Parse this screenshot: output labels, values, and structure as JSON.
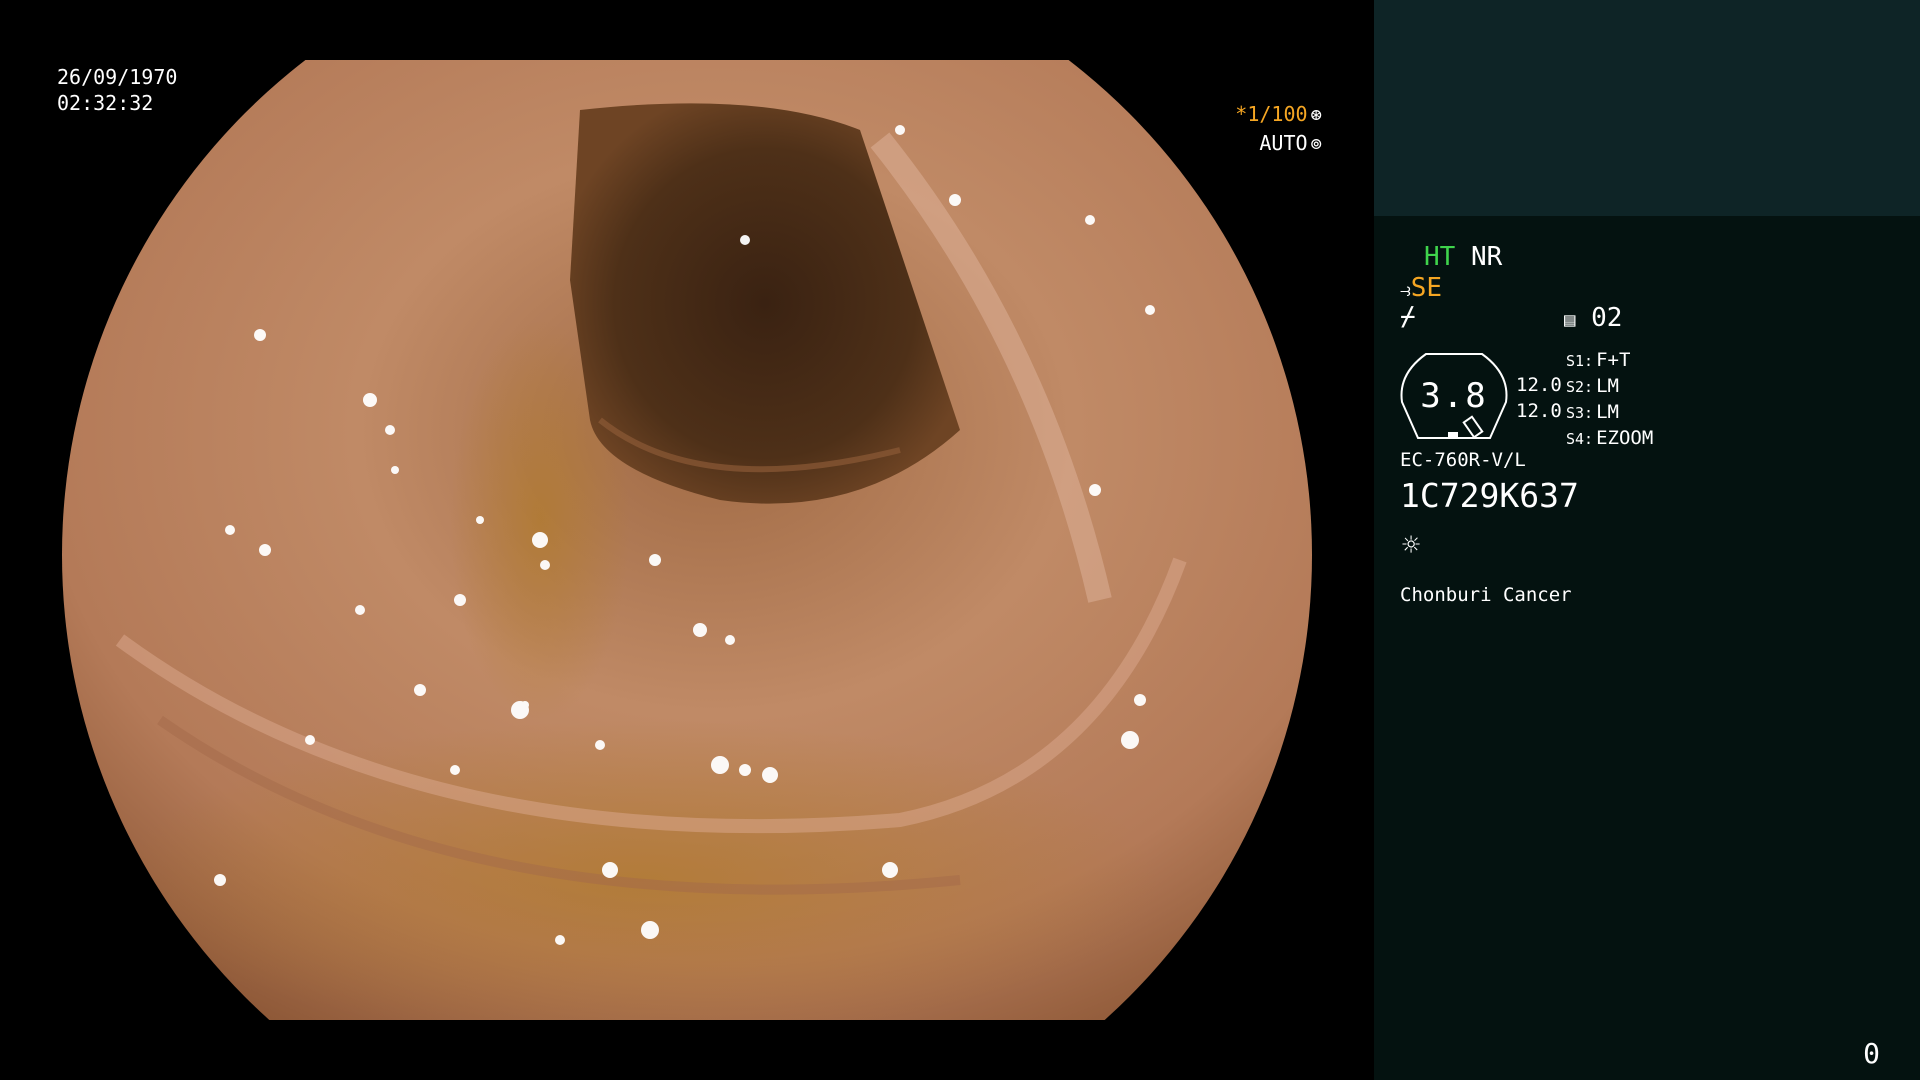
{
  "overlay": {
    "date": "26/09/1970",
    "time": "02:32:32",
    "shutter": "*1/100",
    "shutter_icon": "aperture-icon",
    "iris_mode": "AUTO",
    "iris_icon": "iris-icon"
  },
  "panel": {
    "ht": "HT",
    "nr": "NR",
    "se_icon": "cable-icon",
    "se": "SE",
    "freeze_icon": "freeze-icon",
    "memory_icon": "memory-card-icon",
    "memory": "02",
    "gauge_value": "3.8",
    "gauge_vals": [
      "12.0",
      "12.0"
    ],
    "switches": [
      {
        "label": "S1:",
        "value": "F+T"
      },
      {
        "label": "S2:",
        "value": "LM"
      },
      {
        "label": "S3:",
        "value": "LM"
      },
      {
        "label": "S4:",
        "value": "EZOOM"
      }
    ],
    "scope_model": "EC-760R-V/L",
    "scope_serial": "1C729K637",
    "light_icon": "light-source-icon",
    "hospital": "Chonburi Cancer",
    "counter": "0"
  },
  "colors": {
    "panel_bg": "#041210",
    "panel_top_bg": "#0e2426",
    "ht_green": "#3fd44c",
    "accent_orange": "#f5a623"
  }
}
